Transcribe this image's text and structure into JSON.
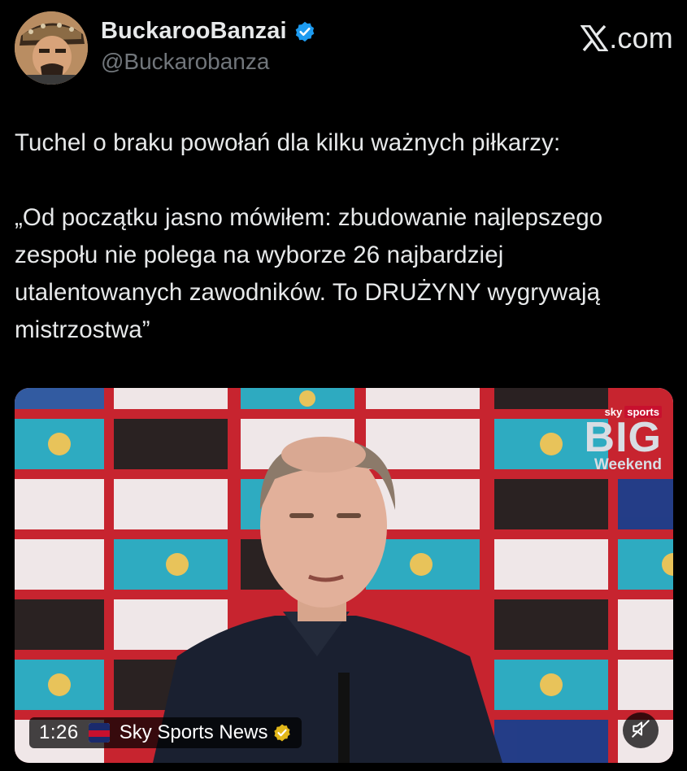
{
  "author": {
    "display_name": "BuckarooBanzai",
    "handle": "@Buckarobanza",
    "verified": true
  },
  "site": {
    "label": ".com",
    "logo_icon": "x-logo-icon"
  },
  "tweet": {
    "text": "Tuchel o braku powołań dla kilku ważnych piłkarzy:\n\n„Od początku jasno mówiłem: zbudowanie najlepszego zespołu nie polega na wyborze 26 najbardziej utalentowanych zawodników. To DRUŻYNY wygrywają mistrzostwa”"
  },
  "media": {
    "type": "video",
    "duration": "1:26",
    "source_name": "Sky Sports News",
    "source_verified": true,
    "watermark": {
      "brand_a": "sky",
      "brand_b": "sports",
      "title": "BIG",
      "subtitle": "Weekend"
    },
    "mute_icon": "muted-speaker-icon"
  },
  "colors": {
    "background": "#000000",
    "text": "#e7e9ea",
    "secondary_text": "#71767b",
    "verified_blue": "#1d9bf0",
    "verified_gold": "#e2b719"
  }
}
